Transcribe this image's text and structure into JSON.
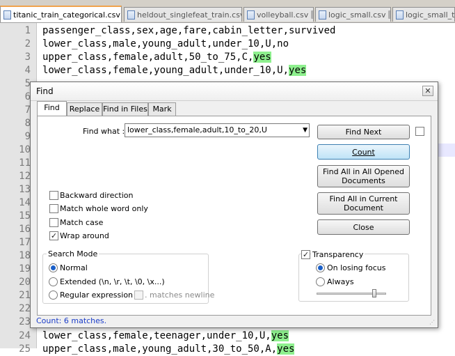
{
  "tabs": [
    {
      "label": "titanic_train_categorical.csv",
      "active": true
    },
    {
      "label": "heldout_singlefeat_train.csv",
      "active": false
    },
    {
      "label": "volleyball.csv",
      "active": false
    },
    {
      "label": "logic_small.csv",
      "active": false
    },
    {
      "label": "logic_small_tes",
      "active": false
    }
  ],
  "editor": {
    "lines": [
      {
        "num": "1",
        "pre": "passenger_class,sex,age,fare,cabin_letter,survived",
        "hl": "",
        "post": ""
      },
      {
        "num": "2",
        "pre": "lower_class,male,young_adult,under_10,U,no",
        "hl": "",
        "post": ""
      },
      {
        "num": "3",
        "pre": "upper_class,female,adult,50_to_75,C,",
        "hl": "yes",
        "post": ""
      },
      {
        "num": "4",
        "pre": "lower_class,female,young_adult,under_10,U,",
        "hl": "yes",
        "post": ""
      },
      {
        "num": "5",
        "pre": "",
        "hl": "",
        "post": ""
      },
      {
        "num": "6",
        "pre": "",
        "hl": "",
        "post": ""
      },
      {
        "num": "7",
        "pre": "",
        "hl": "",
        "post": ""
      },
      {
        "num": "8",
        "pre": "",
        "hl": "",
        "post": ""
      },
      {
        "num": "9",
        "pre": "",
        "hl": "",
        "post": ""
      },
      {
        "num": "10",
        "pre": "",
        "hl": "",
        "post": ""
      },
      {
        "num": "11",
        "pre": "",
        "hl": "",
        "post": ""
      },
      {
        "num": "12",
        "pre": "",
        "hl": "",
        "post": ""
      },
      {
        "num": "13",
        "pre": "",
        "hl": "",
        "post": ""
      },
      {
        "num": "14",
        "pre": "",
        "hl": "",
        "post": ""
      },
      {
        "num": "15",
        "pre": "",
        "hl": "",
        "post": ""
      },
      {
        "num": "16",
        "pre": "",
        "hl": "",
        "post": ""
      },
      {
        "num": "17",
        "pre": "",
        "hl": "",
        "post": ""
      },
      {
        "num": "18",
        "pre": "",
        "hl": "",
        "post": ""
      },
      {
        "num": "19",
        "pre": "",
        "hl": "",
        "post": ""
      },
      {
        "num": "20",
        "pre": "",
        "hl": "",
        "post": ""
      },
      {
        "num": "21",
        "pre": "",
        "hl": "",
        "post": ""
      },
      {
        "num": "22",
        "pre": "",
        "hl": "",
        "post": ""
      },
      {
        "num": "23",
        "pre": "",
        "hl": "",
        "post": ""
      },
      {
        "num": "24",
        "pre": "lower_class,female,teenager,under_10,U,",
        "hl": "yes",
        "post": ""
      },
      {
        "num": "25",
        "pre": "upper_class,male,young_adult,30_to_50,A,",
        "hl": "yes",
        "post": ""
      }
    ]
  },
  "find_dialog": {
    "title": "Find",
    "close_glyph": "✕",
    "tabs": [
      "Find",
      "Replace",
      "Find in Files",
      "Mark"
    ],
    "find_what_label": "Find what :",
    "find_what_value": "lower_class,female,adult,10_to_20,U",
    "buttons": {
      "find_next": "Find Next",
      "count": "Count",
      "find_all_opened_1": "Find All in All Opened",
      "find_all_opened_2": "Documents",
      "find_all_current_1": "Find All in Current",
      "find_all_current_2": "Document",
      "close": "Close"
    },
    "options": {
      "backward": "Backward direction",
      "whole_word": "Match whole word only",
      "match_case": "Match case",
      "wrap_around": "Wrap around"
    },
    "search_mode": {
      "title": "Search Mode",
      "normal": "Normal",
      "extended": "Extended (\\n, \\r, \\t, \\0, \\x...)",
      "regex": "Regular expression",
      "matches_newline": ". matches newline"
    },
    "transparency": {
      "title": "Transparency",
      "on_losing_focus": "On losing focus",
      "always": "Always",
      "slider_value": 0.85
    },
    "status": "Count: 6 matches."
  },
  "colors": {
    "match_highlight": "#8ef08e",
    "active_tab_accent": "#f1a24c",
    "status_text": "#1a3cc8"
  }
}
